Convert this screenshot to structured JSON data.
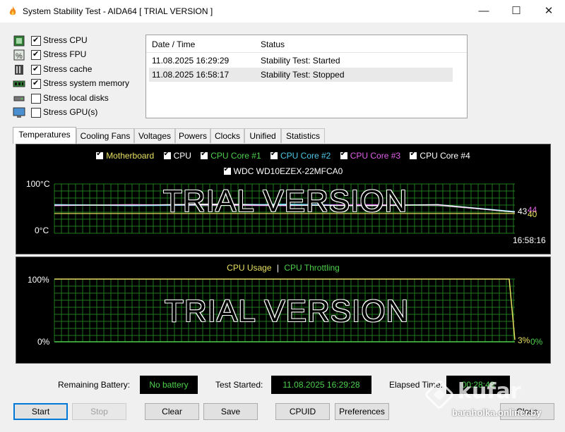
{
  "window": {
    "title": "System Stability Test - AIDA64  [ TRIAL VERSION ]"
  },
  "stress": [
    {
      "label": "Stress CPU",
      "checked": true,
      "icon": "cpu-chip-icon"
    },
    {
      "label": "Stress FPU",
      "checked": true,
      "icon": "fpu-percent-icon"
    },
    {
      "label": "Stress cache",
      "checked": true,
      "icon": "cache-memory-icon"
    },
    {
      "label": "Stress system memory",
      "checked": true,
      "icon": "memory-module-icon"
    },
    {
      "label": "Stress local disks",
      "checked": false,
      "icon": "disk-drive-icon"
    },
    {
      "label": "Stress GPU(s)",
      "checked": false,
      "icon": "monitor-gpu-icon"
    }
  ],
  "log": {
    "col_date": "Date / Time",
    "col_status": "Status",
    "rows": [
      {
        "date": "11.08.2025 16:29:29",
        "status": "Stability Test: Started"
      },
      {
        "date": "11.08.2025 16:58:17",
        "status": "Stability Test: Stopped"
      }
    ]
  },
  "tabs": [
    "Temperatures",
    "Cooling Fans",
    "Voltages",
    "Powers",
    "Clocks",
    "Unified",
    "Statistics"
  ],
  "temp_chart": {
    "legend1": [
      {
        "label": "Motherboard",
        "color": "#e8e060"
      },
      {
        "label": "CPU",
        "color": "#ffffff"
      },
      {
        "label": "CPU Core #1",
        "color": "#4cd04c"
      },
      {
        "label": "CPU Core #2",
        "color": "#4cc8e8"
      },
      {
        "label": "CPU Core #3",
        "color": "#e060e8"
      },
      {
        "label": "CPU Core #4",
        "color": "#ffffff"
      }
    ],
    "legend2": {
      "label": "WDC WD10EZEX-22MFCA0",
      "color": "#ffffff"
    },
    "y_top": "100°C",
    "y_bottom": "0°C",
    "watermark": "TRIAL VERSION",
    "end_values": "43",
    "end_values2": "44",
    "end_values3": "40",
    "time": "16:58:16"
  },
  "cpu_chart": {
    "legend_usage": "CPU Usage",
    "separator": "|",
    "legend_throttle": "CPU Throttling",
    "usage_color": "#e8e060",
    "throttle_color": "#4cd04c",
    "y_top": "100%",
    "y_bottom": "0%",
    "watermark": "TRIAL VERSION",
    "usage_value": "3%",
    "throttle_value": "0%"
  },
  "status": {
    "battery_label": "Remaining Battery:",
    "battery_value": "No battery",
    "started_label": "Test Started:",
    "started_value": "11.08.2025 16:29:28",
    "elapsed_label": "Elapsed Time:",
    "elapsed_value": "00:28:48"
  },
  "buttons": {
    "start": "Start",
    "stop": "Stop",
    "clear": "Clear",
    "save": "Save",
    "cpuid": "CPUID",
    "preferences": "Preferences",
    "close": "Close"
  },
  "watermark": {
    "brand": "kufar",
    "url": "baraholka.onliner.by"
  },
  "chart_data": [
    {
      "type": "line",
      "title": "",
      "ylabel": "",
      "ylim": [
        0,
        100
      ],
      "series": [
        {
          "name": "Motherboard",
          "values": [
            40,
            40
          ]
        },
        {
          "name": "CPU",
          "values": [
            58,
            57,
            59,
            58,
            56,
            57,
            43
          ]
        },
        {
          "name": "CPU Core #1",
          "values": [
            57,
            58,
            56,
            57,
            58,
            56,
            44
          ]
        },
        {
          "name": "CPU Core #2",
          "values": [
            58,
            56,
            57,
            59,
            57,
            58,
            44
          ]
        },
        {
          "name": "CPU Core #3",
          "values": [
            56,
            58,
            57,
            56,
            58,
            57,
            43
          ]
        },
        {
          "name": "CPU Core #4",
          "values": [
            57,
            57,
            58,
            57,
            56,
            58,
            43
          ]
        }
      ]
    },
    {
      "type": "line",
      "title": "",
      "ylabel": "",
      "ylim": [
        0,
        100
      ],
      "series": [
        {
          "name": "CPU Usage",
          "values": [
            100,
            100,
            100,
            100,
            3
          ]
        },
        {
          "name": "CPU Throttling",
          "values": [
            0,
            0,
            0,
            0,
            0
          ]
        }
      ]
    }
  ]
}
